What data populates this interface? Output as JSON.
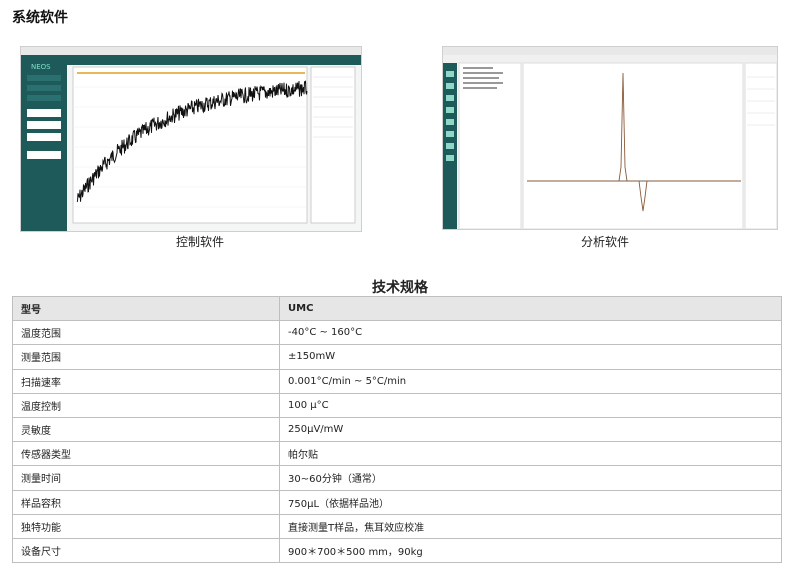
{
  "section_title": "系统软件",
  "screenshots": [
    {
      "caption": "控制软件"
    },
    {
      "caption": "分析软件"
    }
  ],
  "spec_title": "技术规格",
  "spec_header": {
    "key": "型号",
    "value": "UMC"
  },
  "spec_rows": [
    {
      "key": "温度范围",
      "value": "-40°C ~ 160°C"
    },
    {
      "key": "测量范围",
      "value": "±150mW"
    },
    {
      "key": "扫描速率",
      "value": "0.001°C/min ~ 5°C/min"
    },
    {
      "key": "温度控制",
      "value": "100 μ°C"
    },
    {
      "key": "灵敏度",
      "value": "250μV/mW"
    },
    {
      "key": "传感器类型",
      "value": "帕尔贴"
    },
    {
      "key": "测量时间",
      "value": "30~60分钟（通常）"
    },
    {
      "key": "样品容积",
      "value": "750μL（依据样品池）"
    },
    {
      "key": "独特功能",
      "value": "直接测量T样品，焦耳效应校准"
    },
    {
      "key": "设备尺寸",
      "value": "900＊700＊500 mm，90kg"
    }
  ],
  "colors": {
    "sidebar": "#1e5a5a",
    "accent": "#2fb8a0",
    "trace_noise": "#111111",
    "trace_peak": "#8a5a3a"
  }
}
